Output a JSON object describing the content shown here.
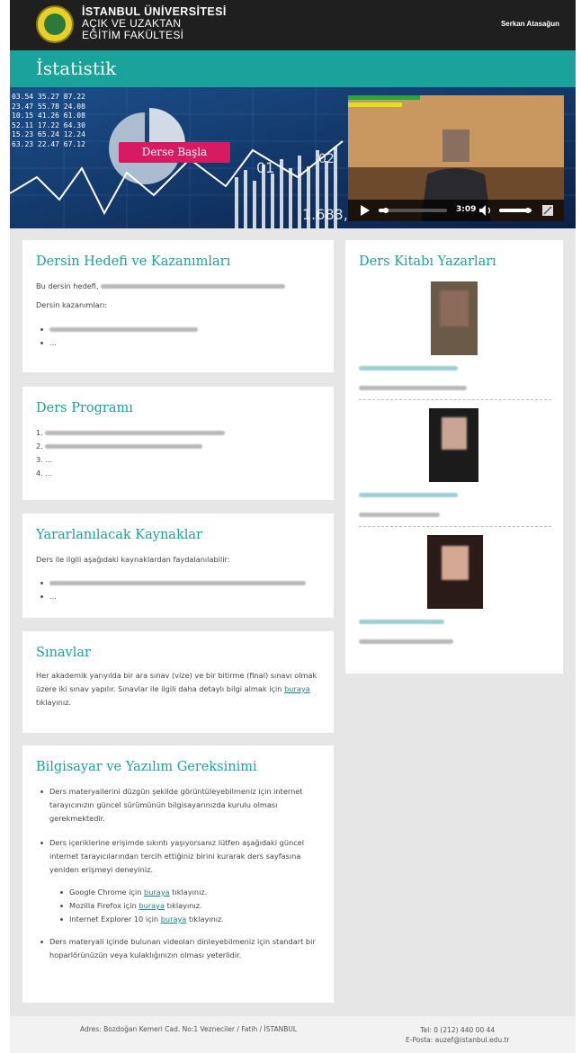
{
  "header": {
    "university_line1": "İSTANBUL ÜNİVERSİTESİ",
    "university_line2": "AÇIK VE UZAKTAN",
    "university_line3": "EĞİTİM FAKÜLTESİ",
    "user_name": "Serkan Atasağun"
  },
  "page": {
    "title": "İstatistik"
  },
  "banner": {
    "start_button": "Derse Başla",
    "video_time": "3:09",
    "numbers_left": [
      "03.54 35.27 87.22",
      "23.47 55.78 24.08",
      "10.15 41.26 61.08",
      "52.11 17.22 64.30",
      "15.23 65.24 12.24",
      "63.23 22.47 67.12"
    ],
    "overlay_numbers": [
      "01",
      "02",
      "1.683,"
    ]
  },
  "goals_card": {
    "title": "Dersin Hedefi ve Kazanımları",
    "intro": "Bu dersin hedefi,",
    "outcomes_label": "Dersin kazanımları:",
    "ellipsis": "..."
  },
  "program_card": {
    "title": "Ders Programı",
    "items": [
      "1.",
      "2.",
      "3. ...",
      "4. ..."
    ]
  },
  "resources_card": {
    "title": "Yararlanılacak Kaynaklar",
    "intro": "Ders ile ilgili aşağıdaki kaynaklardan faydalanılabilir:",
    "ellipsis": "..."
  },
  "exams_card": {
    "title": "Sınavlar",
    "text": "Her akademik yarıyılda bir ara sınav (vize) ve bir bitirme (final) sınavı olmak üzere iki sınav yapılır. Sınavlar ile ilgili daha detaylı bilgi almak için",
    "link": "buraya",
    "suffix": "tıklayınız."
  },
  "requirements_card": {
    "title": "Bilgisayar ve Yazılım Gereksinimi",
    "p1": "Ders materyallerini düzgün şekilde görüntüleyebilmeniz için internet tarayıcınızın güncel sürümünün bilgisayarınızda kurulu olması gerekmektedir.",
    "p2": "Ders içeriklerine erişimde sıkıntı yaşıyorsanız lütfen aşağıdaki güncel internet tarayıcılarından tercih ettiğiniz birini kurarak ders sayfasına yeniden erişmeyi deneyiniz.",
    "chrome_pre": "Google Chrome için",
    "firefox_pre": "Mozilla Firefox için",
    "ie_pre": "Internet Explorer 10 için",
    "link": "buraya",
    "suffix": "tıklayınız.",
    "p3": "Ders materyali içinde bulunan videoları dinleyebilmeniz için standart bir hoparlörünüzün veya kulaklığınızın olması yeterlidir."
  },
  "authors_card": {
    "title": "Ders Kitabı Yazarları"
  },
  "footer": {
    "address": "Adres: Bozdoğan Kemeri Cad. No:1 Vezneciler / Fatih / İSTANBUL",
    "phone": "Tel: 0 (212) 440 00 44",
    "email": "E-Posta: auzef@istanbul.edu.tr"
  },
  "colors": {
    "teal": "#1aa39b",
    "header_bg": "#1f1f1f",
    "button": "#d81b60"
  }
}
